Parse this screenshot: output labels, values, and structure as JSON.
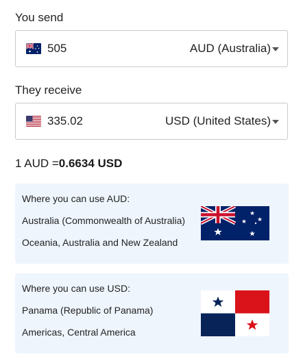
{
  "send": {
    "label": "You send",
    "amount": "505",
    "currency": "AUD (Australia)",
    "flag_icon": "australia-flag-icon"
  },
  "receive": {
    "label": "They receive",
    "amount": "335.02",
    "currency": "USD (United States)",
    "flag_icon": "us-flag-icon"
  },
  "rate": {
    "prefix": "1 AUD =",
    "value": "0.6634 USD"
  },
  "cards": [
    {
      "title": "Where you can use AUD:",
      "country": "Australia (Commonwealth of Australia)",
      "region": "Oceania, Australia and New Zealand",
      "flag_icon": "australia-flag-icon"
    },
    {
      "title": "Where you can use USD:",
      "country": "Panama (Republic of Panama)",
      "region": "Americas, Central America",
      "flag_icon": "panama-flag-icon"
    }
  ],
  "colors": {
    "card_bg": "#eef5fd",
    "border": "#c9c9c9",
    "au_blue": "#012169",
    "au_red": "#C8102E",
    "pa_blue": "#072357",
    "pa_red": "#DA121A"
  }
}
